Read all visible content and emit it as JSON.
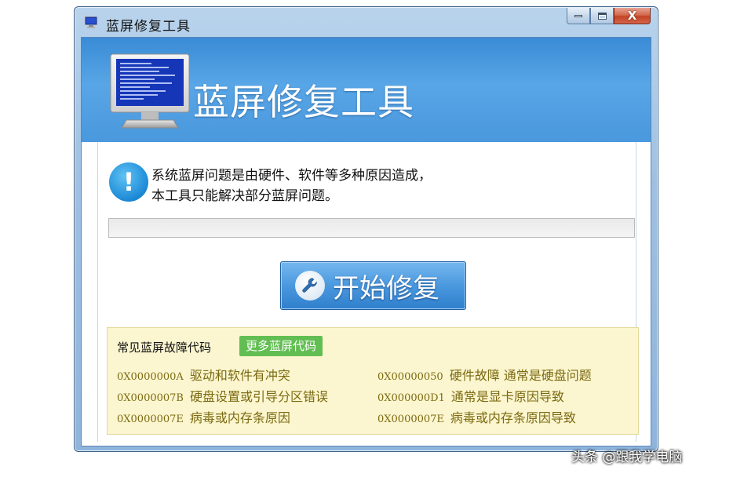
{
  "window": {
    "title": "蓝屏修复工具",
    "minimize_icon": "minimize-icon",
    "maximize_icon": "maximize-icon",
    "close_glyph": "X"
  },
  "banner": {
    "title": "蓝屏修复工具",
    "icon": "bsod-monitor-icon"
  },
  "notice": {
    "icon_glyph": "!",
    "line1": "系统蓝屏问题是由硬件、软件等多种原因造成，",
    "line2": "本工具只能解决部分蓝屏问题。"
  },
  "progress": {
    "value": 0
  },
  "start_button": {
    "label": "开始修复",
    "icon": "wrench-icon"
  },
  "codes_panel": {
    "title": "常见蓝屏故障代码",
    "more_label": "更多蓝屏代码",
    "rows": [
      {
        "code": "0X0000000A",
        "desc": "驱动和软件有冲突"
      },
      {
        "code": "0X00000050",
        "desc": "硬件故障 通常是硬盘问题"
      },
      {
        "code": "0X0000007B",
        "desc": "硬盘设置或引导分区错误"
      },
      {
        "code": "0X000000D1",
        "desc": "通常是显卡原因导致"
      },
      {
        "code": "0X0000007E",
        "desc": "病毒或内存条原因"
      },
      {
        "code": "0X0000007E",
        "desc": "病毒或内存条原因导致"
      }
    ]
  },
  "watermark": "头条 @跟我学电脑",
  "colors": {
    "banner_blue": "#4a98dd",
    "button_blue": "#3d8bd6",
    "more_green": "#62be52",
    "panel_bg": "#fbf6cf",
    "code_text": "#7c6a12"
  }
}
